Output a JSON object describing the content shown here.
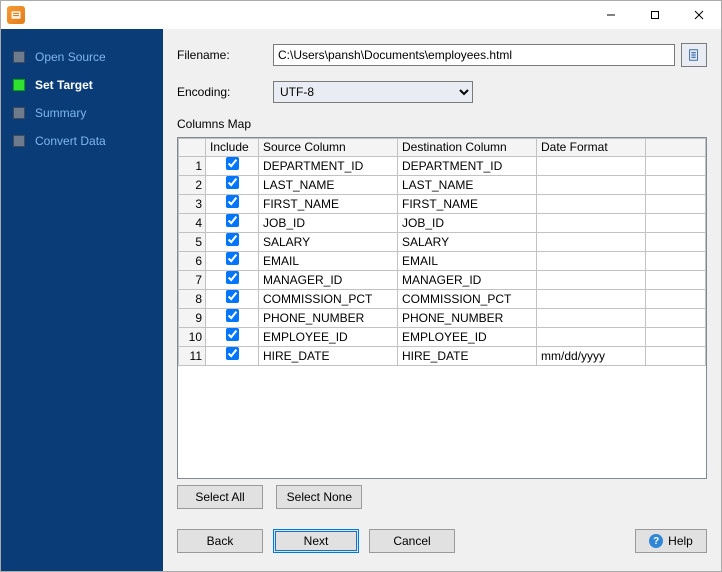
{
  "titlebar": {
    "min_tip": "Minimize",
    "max_tip": "Maximize",
    "close_tip": "Close"
  },
  "sidebar": {
    "steps": [
      {
        "label": "Open Source",
        "active": false
      },
      {
        "label": "Set Target",
        "active": true
      },
      {
        "label": "Summary",
        "active": false
      },
      {
        "label": "Convert Data",
        "active": false
      }
    ]
  },
  "form": {
    "filename_label": "Filename:",
    "filename_value": "C:\\Users\\pansh\\Documents\\employees.html",
    "encoding_label": "Encoding:",
    "encoding_value": "UTF-8"
  },
  "columns": {
    "section_label": "Columns Map",
    "headers": {
      "include": "Include",
      "source": "Source Column",
      "destination": "Destination Column",
      "date_format": "Date Format"
    },
    "rows": [
      {
        "n": "1",
        "include": true,
        "source": "DEPARTMENT_ID",
        "destination": "DEPARTMENT_ID",
        "date_format": ""
      },
      {
        "n": "2",
        "include": true,
        "source": "LAST_NAME",
        "destination": "LAST_NAME",
        "date_format": ""
      },
      {
        "n": "3",
        "include": true,
        "source": "FIRST_NAME",
        "destination": "FIRST_NAME",
        "date_format": ""
      },
      {
        "n": "4",
        "include": true,
        "source": "JOB_ID",
        "destination": "JOB_ID",
        "date_format": ""
      },
      {
        "n": "5",
        "include": true,
        "source": "SALARY",
        "destination": "SALARY",
        "date_format": ""
      },
      {
        "n": "6",
        "include": true,
        "source": "EMAIL",
        "destination": "EMAIL",
        "date_format": ""
      },
      {
        "n": "7",
        "include": true,
        "source": "MANAGER_ID",
        "destination": "MANAGER_ID",
        "date_format": ""
      },
      {
        "n": "8",
        "include": true,
        "source": "COMMISSION_PCT",
        "destination": "COMMISSION_PCT",
        "date_format": ""
      },
      {
        "n": "9",
        "include": true,
        "source": "PHONE_NUMBER",
        "destination": "PHONE_NUMBER",
        "date_format": ""
      },
      {
        "n": "10",
        "include": true,
        "source": "EMPLOYEE_ID",
        "destination": "EMPLOYEE_ID",
        "date_format": ""
      },
      {
        "n": "11",
        "include": true,
        "source": "HIRE_DATE",
        "destination": "HIRE_DATE",
        "date_format": "mm/dd/yyyy"
      }
    ]
  },
  "buttons": {
    "select_all": "Select All",
    "select_none": "Select None",
    "back": "Back",
    "next": "Next",
    "cancel": "Cancel",
    "help": "Help"
  }
}
